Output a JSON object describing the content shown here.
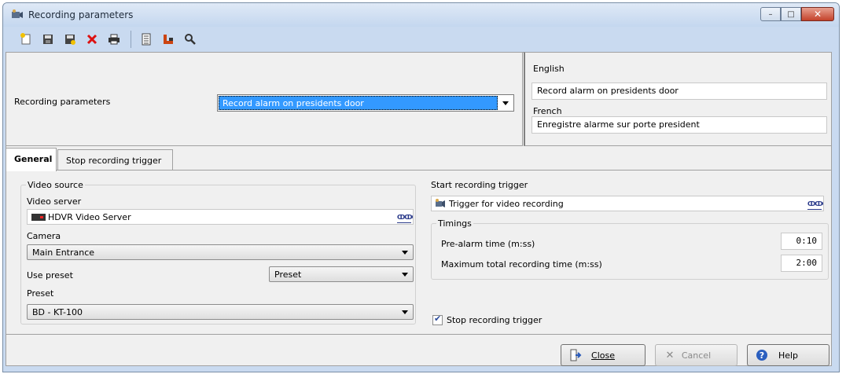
{
  "window": {
    "title": "Recording parameters",
    "buttons": {
      "minimize": "–",
      "maximize": "□",
      "close": "✕"
    }
  },
  "toolbar": {
    "icons": [
      "new-icon",
      "save-icon",
      "save-as-icon",
      "delete-icon",
      "print-icon",
      "list-icon",
      "links-icon",
      "find-icon"
    ]
  },
  "header": {
    "label": "Recording parameters",
    "selected_value": "Record alarm on presidents door"
  },
  "languages": {
    "english_label": "English",
    "english_value": "Record alarm on presidents door",
    "french_label": "French",
    "french_value": "Enregistre alarme sur porte president"
  },
  "tabs": [
    {
      "label": "General",
      "active": true
    },
    {
      "label": "Stop recording trigger",
      "active": false
    }
  ],
  "video_source": {
    "group_title": "Video source",
    "video_server_label": "Video server",
    "video_server_value": "HDVR Video Server",
    "camera_label": "Camera",
    "camera_value": "Main Entrance",
    "use_preset_label": "Use preset",
    "use_preset_value": "Preset",
    "preset_label": "Preset",
    "preset_value": "BD - KT-100"
  },
  "start_trigger": {
    "label": "Start recording trigger",
    "value": "Trigger for video recording"
  },
  "timings": {
    "group_title": "Timings",
    "pre_alarm_label": "Pre-alarm time (m:ss)",
    "pre_alarm_value": "0:10",
    "max_total_label": "Maximum total recording time (m:ss)",
    "max_total_value": "2:00"
  },
  "stop_trigger_checkbox": {
    "label": "Stop recording trigger",
    "checked": true
  },
  "footer": {
    "close_label": "Close",
    "cancel_label": "Cancel",
    "help_label": "Help"
  },
  "colors": {
    "selection": "#3399ff",
    "window_frame": "#c9daf0"
  }
}
